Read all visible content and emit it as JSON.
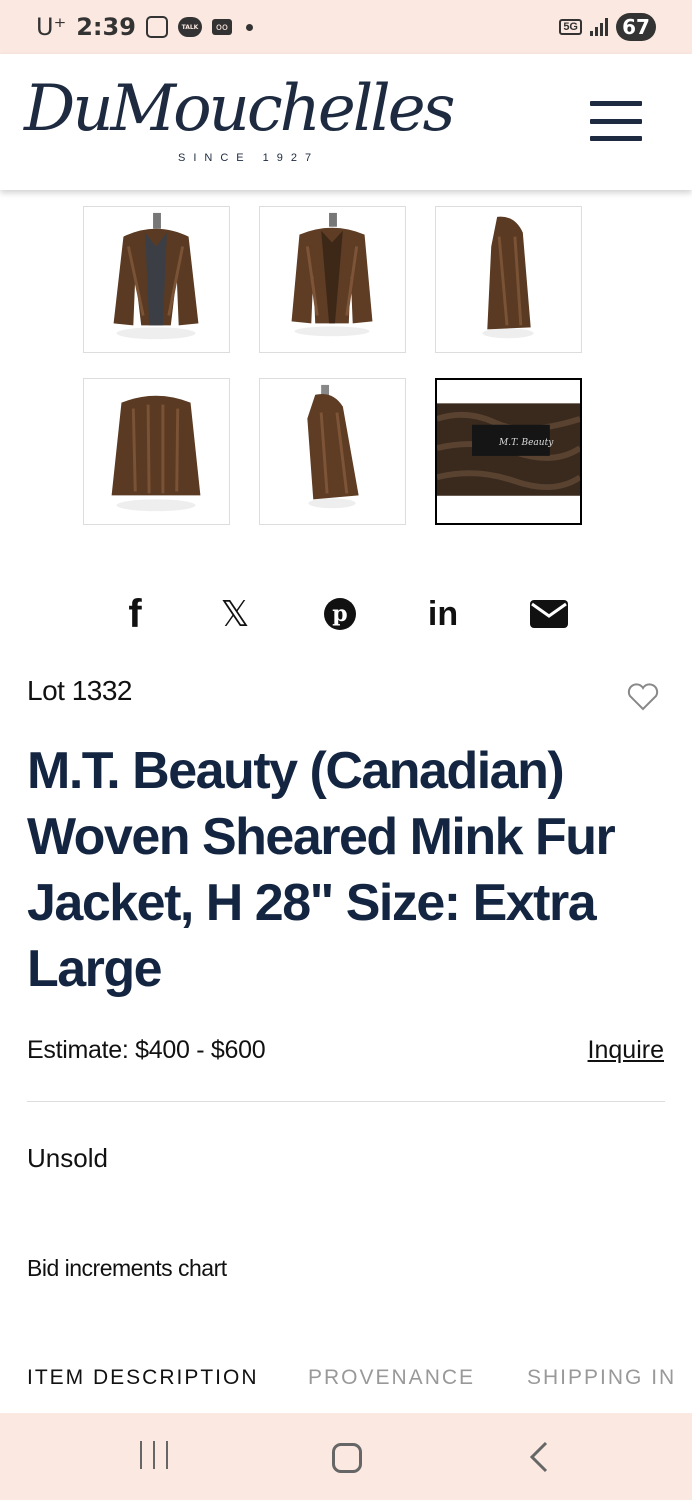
{
  "status_bar": {
    "carrier": "U⁺",
    "time": "2:39",
    "talk_label": "TALK",
    "voicemail": "oo",
    "network": "5G",
    "battery": "67"
  },
  "header": {
    "logo_text": "DuMouchelles",
    "logo_since": "SINCE 1927",
    "menu_icon": "hamburger-icon"
  },
  "gallery": {
    "thumbnails": [
      "front-with-mannequin",
      "front",
      "side",
      "back",
      "side-2",
      "label"
    ],
    "active_index": 5,
    "label_text": "M.T. Beauty"
  },
  "share": {
    "facebook": "f",
    "x": "𝕏",
    "pinterest": "p",
    "linkedin": "in",
    "email": "email-icon"
  },
  "lot": {
    "number": "Lot 1332",
    "title": "M.T. Beauty (Canadian) Woven Sheared Mink Fur Jacket, H 28\" Size: Extra Large",
    "estimate": "Estimate: $400 - $600",
    "inquire": "Inquire",
    "status": "Unsold",
    "bid_increments": "Bid increments chart"
  },
  "tabs": [
    {
      "label": "ITEM DESCRIPTION",
      "active": true
    },
    {
      "label": "PROVENANCE",
      "active": false
    },
    {
      "label": "SHIPPING IN",
      "active": false
    }
  ],
  "colors": {
    "brand_navy": "#132540",
    "system_bar": "#fbe9e1"
  }
}
